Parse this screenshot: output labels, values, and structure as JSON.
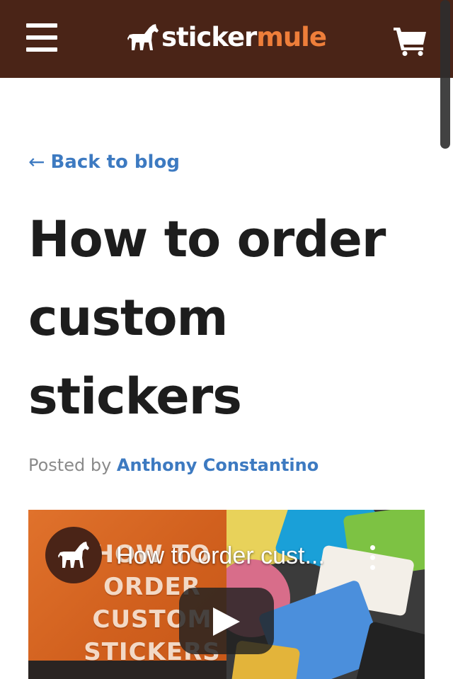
{
  "header": {
    "logo_part1": "sticker",
    "logo_part2": "mule",
    "menu_icon": "hamburger-menu-icon",
    "cart_icon": "shopping-cart-icon"
  },
  "article": {
    "back_arrow": "←",
    "back_label": "Back to blog",
    "title": "How to order custom stickers",
    "posted_by": "Posted by",
    "author": "Anthony Constantino"
  },
  "video": {
    "thumbnail_text": [
      "HOW TO",
      "ORDER",
      "CUSTOM",
      "STICKERS"
    ],
    "title": "How to order cust...",
    "avatar_icon": "mule-logo-icon",
    "play_icon": "play-icon",
    "more_icon": "more-vertical-icon"
  },
  "colors": {
    "header_bg": "#4a2417",
    "brand_orange": "#ee7e3a",
    "link_blue": "#3d7ac1",
    "title_text": "#1d1d1d"
  }
}
